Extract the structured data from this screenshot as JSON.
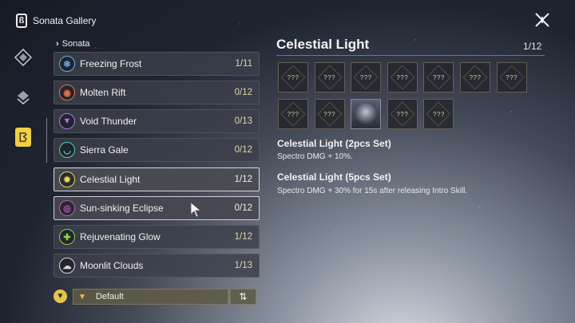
{
  "header": {
    "title": "Sonata Gallery",
    "app_icon": "sonata-icon",
    "close_icon": "close-x-icon"
  },
  "rail": {
    "icons": [
      "echo-diamond-icon",
      "stack-icon",
      "sonata-active-icon"
    ]
  },
  "breadcrumb": {
    "label": "Sonata"
  },
  "sets": [
    {
      "name": "Freezing Frost",
      "count": "1/11",
      "icon": "snowflake-icon",
      "color": "#5ab4e8",
      "glyph": "❄"
    },
    {
      "name": "Molten Rift",
      "count": "0/12",
      "icon": "flame-icon",
      "color": "#e8704a",
      "glyph": "◉"
    },
    {
      "name": "Void Thunder",
      "count": "0/13",
      "icon": "thunder-icon",
      "color": "#a874e0",
      "glyph": "▼"
    },
    {
      "name": "Sierra Gale",
      "count": "0/12",
      "icon": "wind-icon",
      "color": "#4fd4a8",
      "glyph": "◡"
    },
    {
      "name": "Celestial Light",
      "count": "1/12",
      "icon": "light-icon",
      "color": "#e8d45a",
      "glyph": "✹"
    },
    {
      "name": "Sun-sinking Eclipse",
      "count": "0/12",
      "icon": "eclipse-icon",
      "color": "#c05ac0",
      "glyph": "◎"
    },
    {
      "name": "Rejuvenating Glow",
      "count": "1/12",
      "icon": "glow-icon",
      "color": "#8ad44a",
      "glyph": "✚"
    },
    {
      "name": "Moonlit Clouds",
      "count": "1/13",
      "icon": "cloud-icon",
      "color": "#d8d8d8",
      "glyph": "☁"
    }
  ],
  "filter": {
    "sort_label": "Default",
    "filter_icon": "filter-icon",
    "sort_icon": "sort-order-icon"
  },
  "detail": {
    "title": "Celestial Light",
    "count": "1/12",
    "slots": [
      "???",
      "???",
      "???",
      "???",
      "???",
      "???",
      "???",
      "???",
      "???",
      "",
      "???",
      "???"
    ],
    "owned_slot_index": 9,
    "set2_title": "Celestial Light (2pcs Set)",
    "set2_desc": "Spectro DMG + 10%.",
    "set5_title": "Celestial Light (5pcs Set)",
    "set5_desc": "Spectro DMG + 30% for 15s after releasing Intro Skill."
  }
}
